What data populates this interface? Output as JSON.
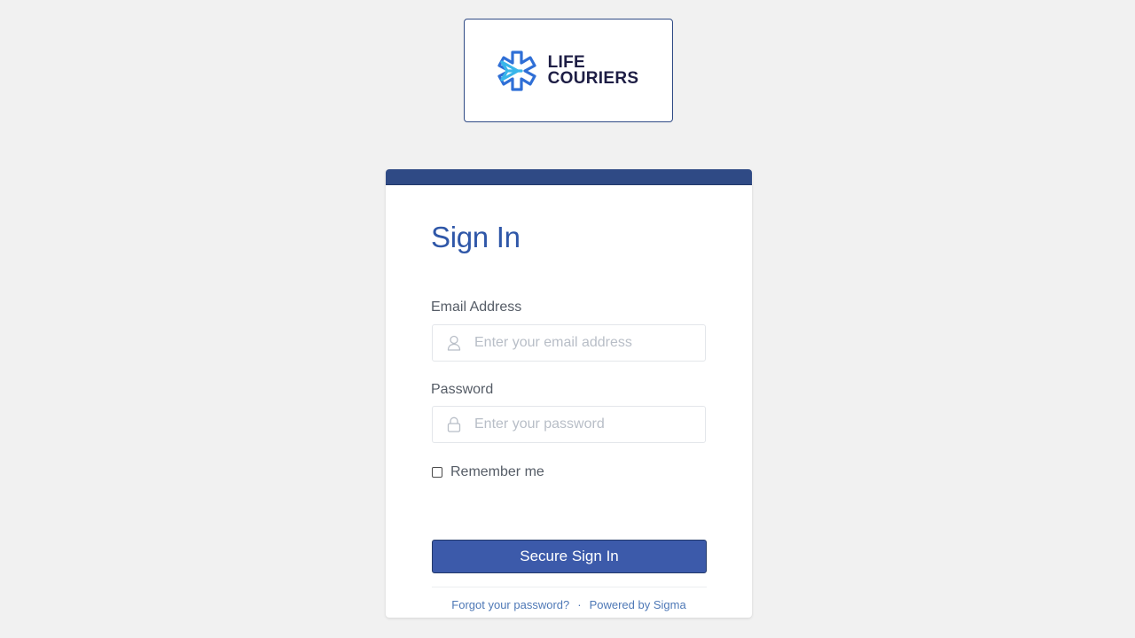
{
  "brand": {
    "line1": "LIFE",
    "line2": "COURIERS",
    "primary_color": "#2f4a85",
    "accent_color": "#3c5aaa",
    "logo_icon": "caduceus-star-arrow-icon"
  },
  "signin": {
    "title": "Sign In",
    "email": {
      "label": "Email Address",
      "placeholder": "Enter your email address",
      "value": "",
      "icon": "user-icon"
    },
    "password": {
      "label": "Password",
      "placeholder": "Enter your password",
      "value": "",
      "icon": "lock-icon"
    },
    "remember": {
      "label": "Remember me",
      "checked": false
    },
    "submit_label": "Secure Sign In"
  },
  "footer": {
    "forgot_label": "Forgot your password?",
    "separator": "·",
    "powered_label": "Powered by Sigma"
  }
}
